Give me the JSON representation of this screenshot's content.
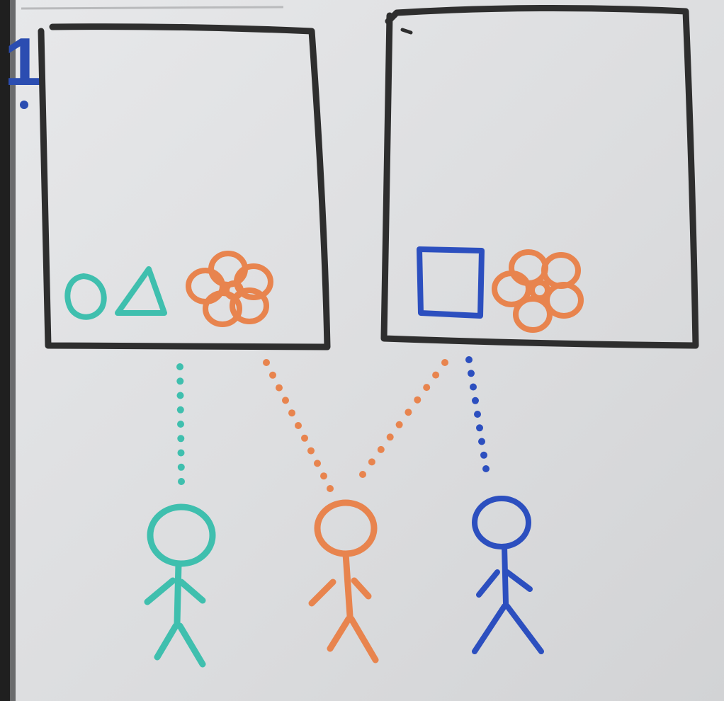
{
  "board": {
    "number": "1",
    "number_color": "#2b4db1"
  },
  "colors": {
    "frame": "#2e2e2e",
    "teal": "#3fbfae",
    "orange": "#e8844e",
    "blue": "#2c4fbf",
    "board_frame": "#1a1a1a"
  },
  "panels": [
    {
      "name": "left-panel",
      "contents": [
        "circle-icon",
        "triangle-icon",
        "flower-icon"
      ]
    },
    {
      "name": "right-panel",
      "contents": [
        "square-icon",
        "flower-icon"
      ]
    }
  ],
  "people": [
    {
      "name": "teal-person",
      "color": "teal",
      "sees": [
        "left-panel"
      ]
    },
    {
      "name": "orange-person",
      "color": "orange",
      "sees": [
        "left-panel",
        "right-panel"
      ]
    },
    {
      "name": "blue-person",
      "color": "blue",
      "sees": [
        "right-panel"
      ]
    }
  ]
}
